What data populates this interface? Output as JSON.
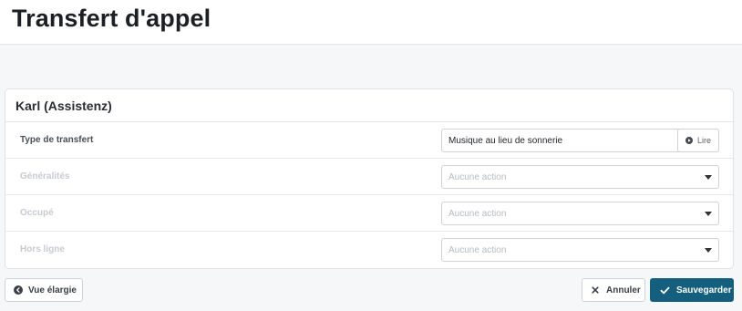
{
  "header": {
    "title": "Transfert d'appel"
  },
  "card": {
    "title": "Karl (Assistenz)",
    "rows": [
      {
        "label": "Type de transfert",
        "value": "Musique au lieu de sonnerie",
        "muted": false
      },
      {
        "label": "Généralités",
        "value": "Aucune action",
        "muted": true
      },
      {
        "label": "Occupé",
        "value": "Aucune action",
        "muted": true
      },
      {
        "label": "Hors ligne",
        "value": "Aucune action",
        "muted": true
      }
    ],
    "play_label": "Lire"
  },
  "footer": {
    "wide_view_label": "Vue élargie",
    "cancel_label": "Annuler",
    "save_label": "Sauvegarder"
  },
  "colors": {
    "primary": "#145f7d",
    "background": "#f6f7f9",
    "muted_text": "#c7cbd1"
  },
  "icons": {
    "play": "play-circle-icon",
    "wide_view": "arrow-left-circle-icon",
    "cancel": "close-icon",
    "save": "check-icon",
    "dropdown": "caret-down-icon"
  }
}
